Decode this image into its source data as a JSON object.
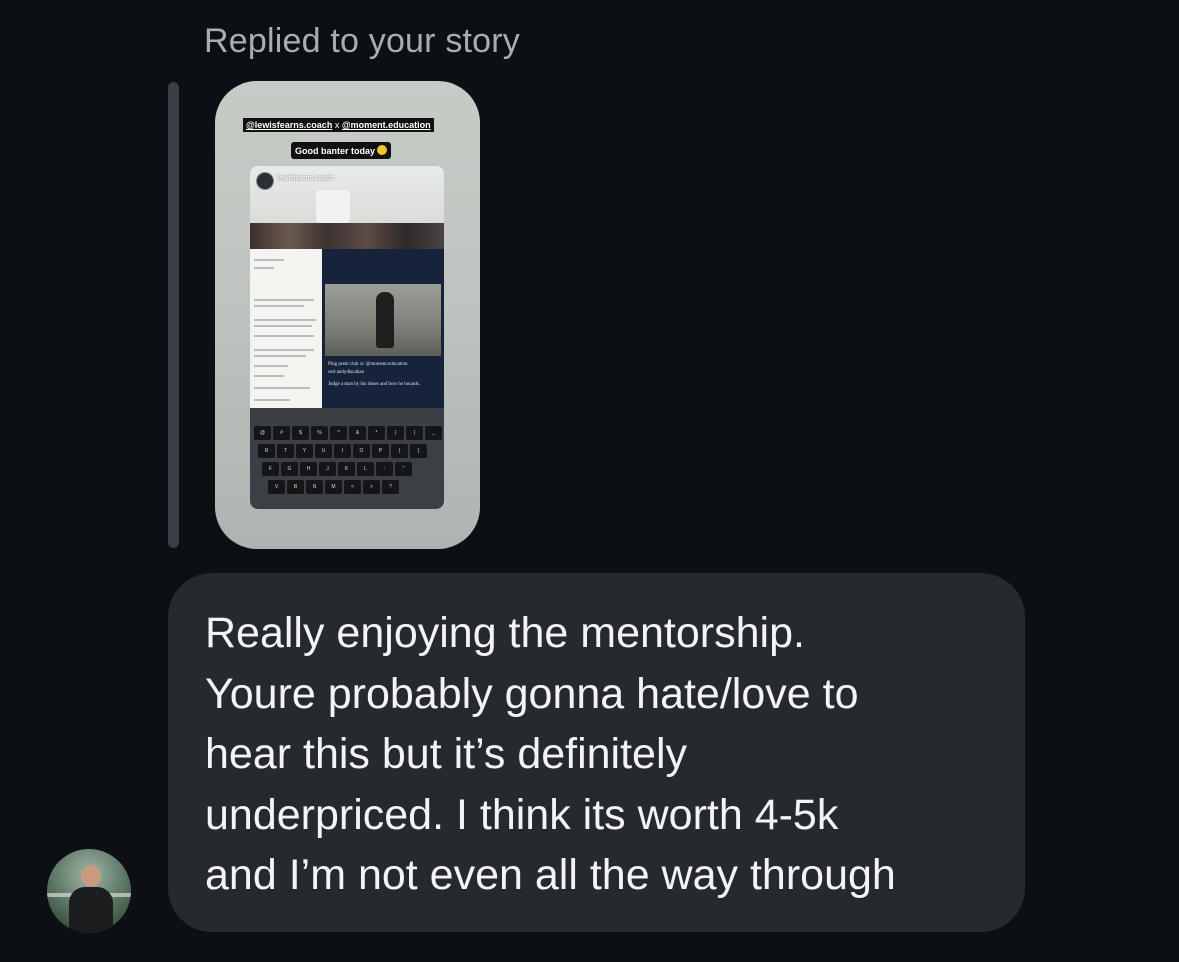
{
  "thread": {
    "reply_label": "Replied to your story"
  },
  "story": {
    "tag_user_1": "@lewisfearns.coach",
    "tag_separator": "x",
    "tag_user_2": "@moment.education",
    "caption": "Good banter today",
    "inner_username": "lewisfearns.coach",
    "video_line_1": "Plug prem club xc @moment.education",
    "video_line_2": "sod·andydlacahan",
    "video_line_3": "Judge a man by his shoes and how he bounds.",
    "keys_row_1": [
      "@",
      "#",
      "$",
      "%",
      "^",
      "&",
      "*",
      "(",
      ")",
      "_"
    ],
    "keys_row_2": [
      "R",
      "T",
      "Y",
      "U",
      "I",
      "O",
      "P",
      "{",
      "}"
    ],
    "keys_row_3": [
      "F",
      "G",
      "H",
      "J",
      "K",
      "L",
      ":",
      "\""
    ],
    "keys_row_4": [
      "V",
      "B",
      "N",
      "M",
      "<",
      ">",
      "?"
    ]
  },
  "message": {
    "text": "Really enjoying the mentorship.\nYoure probably gonna hate/love to\nhear this but it’s definitely\nunderpriced. I think its worth 4-5k\nand I’m not even all the way through"
  },
  "sender": {
    "avatar_icon": "profile-photo"
  }
}
